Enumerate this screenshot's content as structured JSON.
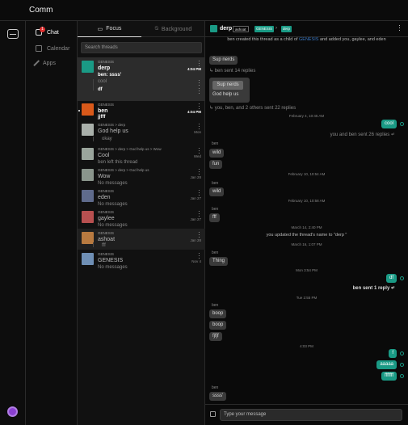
{
  "app": {
    "title": "Comm",
    "chat_badge": "1"
  },
  "nav": [
    {
      "label": "Chat",
      "icon": "chat-icon",
      "active": true
    },
    {
      "label": "Calendar",
      "icon": "calendar-icon",
      "active": false
    },
    {
      "label": "Apps",
      "icon": "apps-icon",
      "active": false
    }
  ],
  "threads_panel": {
    "tabs": [
      {
        "label": "Focus",
        "icon": "chat-bubble-icon",
        "active": true
      },
      {
        "label": "Background",
        "icon": "bell-off-icon",
        "active": false
      }
    ],
    "search_placeholder": "Search threads",
    "threads": [
      {
        "community": "GENESIS",
        "name": "derp",
        "last": "ben: ssss'",
        "time": "4:04 PM",
        "color": "#1a9a85",
        "bold": true,
        "selected": true
      },
      {
        "community": "GENESIS",
        "name": "ben",
        "last": "jjfff",
        "time": "4:04 PM",
        "color": "#d9591a",
        "bold": true,
        "selected": false
      },
      {
        "community": "GENESIS > derp",
        "name": "God help us",
        "last": "",
        "time": "Mon",
        "color": "#a9b0aa",
        "bold": false,
        "selected": false
      },
      {
        "community": "GENESIS > derp > God help us > Wow",
        "name": "Cool",
        "last": "ben left this thread",
        "time": "Wed",
        "color": "#9aa59c",
        "bold": false,
        "selected": false
      },
      {
        "community": "GENESIS > derp > God help us",
        "name": "Wow",
        "last": "No messages",
        "time": "Jan 28",
        "color": "#8a958c",
        "bold": false,
        "selected": false
      },
      {
        "community": "GENESIS",
        "name": "eden",
        "last": "No messages",
        "time": "Jan 27",
        "color": "#5f6b8c",
        "bold": false,
        "selected": false
      },
      {
        "community": "GENESIS",
        "name": "gaylee",
        "last": "No messages",
        "time": "Jan 27",
        "color": "#b85050",
        "bold": false,
        "selected": false
      },
      {
        "community": "GENESIS",
        "name": "ashoat",
        "last": "",
        "time": "Jan 28",
        "color": "#b87a40",
        "bold": false,
        "selected": false
      },
      {
        "community": "GENESIS",
        "name": "GENESIS",
        "last": "No messages",
        "time": "Nov 4",
        "color": "#6f8fb5",
        "bold": false,
        "selected": false
      }
    ],
    "subthreads": {
      "derp": [
        "cool",
        "df"
      ],
      "god_help_us": [
        "okay"
      ],
      "ashoat": [
        "fff"
      ]
    }
  },
  "conversation": {
    "title": "derp",
    "crumbs": [
      "ashoat",
      "GENESIS",
      "derp"
    ],
    "header_colors": {
      "avatar": "#1a9a85",
      "genesis": "#1a9a85",
      "derp": "#1a9a85"
    },
    "messages": {
      "sys_created": "ben created this thread as a child of",
      "sys_created_link": "GENESIS",
      "sys_created_tail": "and added you, gaylee, and eden",
      "m1": "Sup nerds",
      "r1": "↳ ben sent 14 replies",
      "quote_inner": "Sup nerds",
      "quote_text": "God help us",
      "r2": "↳ you, ben, and 2 others sent 22 replies",
      "t1": "February 4, 10:45 AM",
      "mine1": "cool",
      "r3": "you and ben sent 26 replies ↵",
      "s1": "ben",
      "m2": "wild",
      "m3": "fun",
      "t2": "February 10, 10:54 AM",
      "s2": "ben",
      "m4": "wild",
      "t3": "February 10, 10:58 AM",
      "s3": "ben",
      "m5": "fff",
      "t4": "March 14, 2:40 PM",
      "sys_rename": "you updated the thread's name to \"derp \"",
      "t5": "March 16, 1:07 PM",
      "s4": "ben",
      "m6": "Thing",
      "t6": "Mon 3:54 PM",
      "mine2": "df",
      "r4": "ben sent 1 reply ↵",
      "t7": "Tue 2:55 PM",
      "s5": "ben",
      "m7": "boop",
      "m8": "boop",
      "m9": "fjfjf",
      "t8": "4:03 PM",
      "mine3": "f",
      "mine4": "aaaaa",
      "mine5": "fffffff",
      "s6": "ben",
      "m10": "ssss'"
    },
    "input_placeholder": "Type your message"
  }
}
